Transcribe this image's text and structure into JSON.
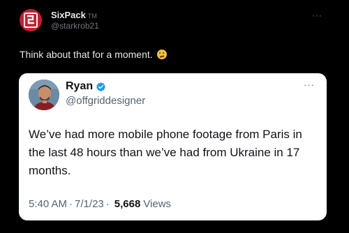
{
  "outer_tweet": {
    "display_name": "SixPack",
    "tm": "TM",
    "handle": "@starkrob21",
    "more": "···",
    "text": "Think about that for a moment.",
    "emoji": "thinking-face",
    "avatar_color": "#c91d2e"
  },
  "quoted_tweet": {
    "display_name": "Ryan",
    "verified": true,
    "verified_color": "#1d9bf0",
    "handle": "@offgriddesigner",
    "more": "···",
    "text": "We’ve had more mobile phone footage from Paris in the last 48 hours than we’ve had from Ukraine in 17 months.",
    "time": "5:40 AM",
    "separator": "·",
    "date": "7/1/23",
    "views_count": "5,668",
    "views_label": "Views"
  }
}
